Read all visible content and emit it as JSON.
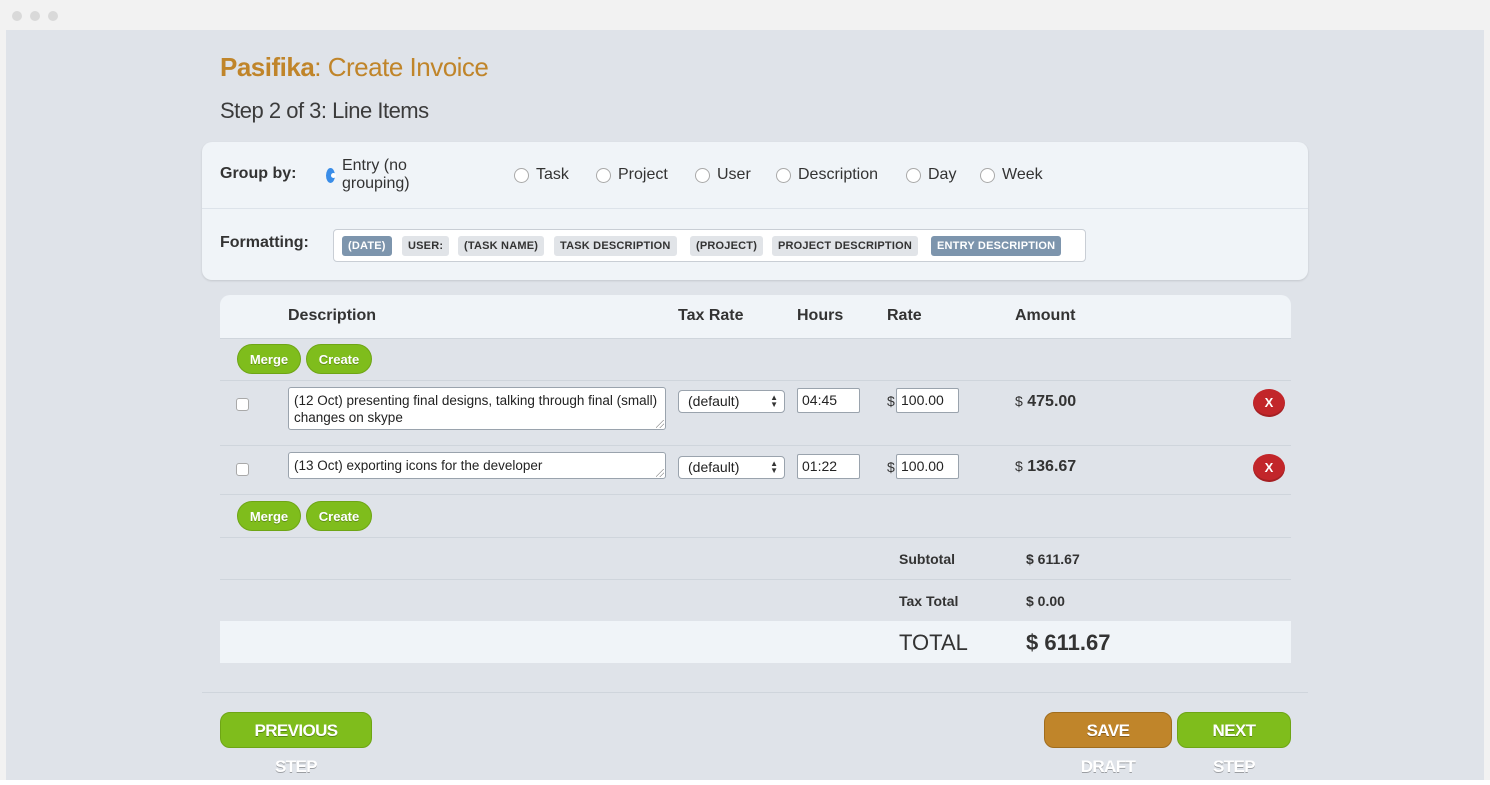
{
  "app": {
    "brand": "Pasifika",
    "title_suffix": ": Create Invoice",
    "step": "Step 2 of 3: Line Items"
  },
  "group_by": {
    "label": "Group by:",
    "options": [
      "Entry (no grouping)",
      "Task",
      "Project",
      "User",
      "Description",
      "Day",
      "Week"
    ],
    "selected": "Entry (no grouping)"
  },
  "formatting": {
    "label": "Formatting:",
    "tags": [
      "(DATE)",
      "USER:",
      "(TASK NAME)",
      "TASK DESCRIPTION",
      "(PROJECT)",
      "PROJECT DESCRIPTION",
      "ENTRY DESCRIPTION"
    ],
    "active_tags": [
      "(DATE)",
      "ENTRY DESCRIPTION"
    ]
  },
  "table": {
    "headers": {
      "description": "Description",
      "tax_rate": "Tax Rate",
      "hours": "Hours",
      "rate": "Rate",
      "amount": "Amount"
    },
    "merge_label": "Merge",
    "create_label": "Create",
    "currency": "$",
    "remove_label": "X",
    "rows": [
      {
        "description": "(12 Oct) presenting final designs, talking through final (small) changes on skype",
        "tax_rate": "(default)",
        "hours": "04:45",
        "rate": "100.00",
        "amount": "475.00"
      },
      {
        "description": "(13 Oct) exporting icons for the developer",
        "tax_rate": "(default)",
        "hours": "01:22",
        "rate": "100.00",
        "amount": "136.67"
      }
    ]
  },
  "summary": {
    "subtotal_label": "Subtotal",
    "subtotal_value": "$ 611.67",
    "tax_label": "Tax Total",
    "tax_value": "$ 0.00",
    "total_label": "TOTAL",
    "total_value": "$ 611.67"
  },
  "footer": {
    "previous": "PREVIOUS STEP",
    "save_draft": "SAVE DRAFT",
    "next": "NEXT STEP"
  },
  "colors": {
    "brand": "#c0852a",
    "green": "#7fbd1c",
    "remove_red": "#c2262a",
    "tag_active": "#7d95ad",
    "radio_selected": "#3a8de8"
  }
}
